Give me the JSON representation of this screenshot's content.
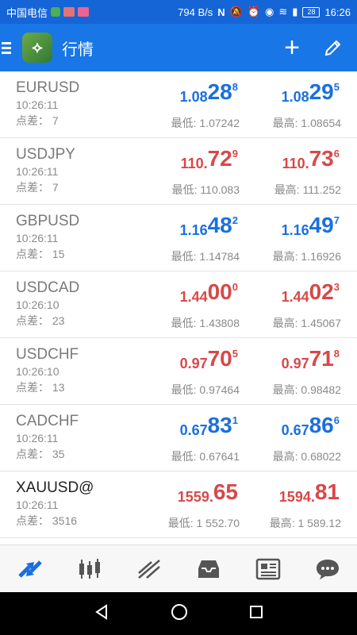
{
  "status_bar": {
    "carrier": "中国电信",
    "speed": "794 B/s",
    "battery": "28",
    "time": "16:26"
  },
  "app_bar": {
    "title": "行情"
  },
  "colors": {
    "primary": "#1976e6",
    "bid_ask_up": "#1a6fe0",
    "bid_ask_down": "#d84848"
  },
  "quotes": [
    {
      "symbol": "EURUSD",
      "time": "10:26:11",
      "spread_label": "点差：",
      "spread": "7",
      "bid": {
        "small": "1.08",
        "big": "28",
        "sup": "8",
        "color": "blue"
      },
      "ask": {
        "small": "1.08",
        "big": "29",
        "sup": "5",
        "color": "blue"
      },
      "low": "最低: 1.07242",
      "high": "最高: 1.08654"
    },
    {
      "symbol": "USDJPY",
      "time": "10:26:11",
      "spread_label": "点差：",
      "spread": "7",
      "bid": {
        "small": "110.",
        "big": "72",
        "sup": "9",
        "color": "red"
      },
      "ask": {
        "small": "110.",
        "big": "73",
        "sup": "6",
        "color": "red"
      },
      "low": "最低: 110.083",
      "high": "最高: 111.252"
    },
    {
      "symbol": "GBPUSD",
      "time": "10:26:11",
      "spread_label": "点差：",
      "spread": "15",
      "bid": {
        "small": "1.16",
        "big": "48",
        "sup": "2",
        "color": "blue"
      },
      "ask": {
        "small": "1.16",
        "big": "49",
        "sup": "7",
        "color": "blue"
      },
      "low": "最低: 1.14784",
      "high": "最高: 1.16926"
    },
    {
      "symbol": "USDCAD",
      "time": "10:26:10",
      "spread_label": "点差：",
      "spread": "23",
      "bid": {
        "small": "1.44",
        "big": "00",
        "sup": "0",
        "color": "red"
      },
      "ask": {
        "small": "1.44",
        "big": "02",
        "sup": "3",
        "color": "red"
      },
      "low": "最低: 1.43808",
      "high": "最高: 1.45067"
    },
    {
      "symbol": "USDCHF",
      "time": "10:26:10",
      "spread_label": "点差：",
      "spread": "13",
      "bid": {
        "small": "0.97",
        "big": "70",
        "sup": "5",
        "color": "red"
      },
      "ask": {
        "small": "0.97",
        "big": "71",
        "sup": "8",
        "color": "red"
      },
      "low": "最低: 0.97464",
      "high": "最高: 0.98482"
    },
    {
      "symbol": "CADCHF",
      "time": "10:26:11",
      "spread_label": "点差：",
      "spread": "35",
      "bid": {
        "small": "0.67",
        "big": "83",
        "sup": "1",
        "color": "blue"
      },
      "ask": {
        "small": "0.67",
        "big": "86",
        "sup": "6",
        "color": "blue"
      },
      "low": "最低: 0.67641",
      "high": "最高: 0.68022"
    },
    {
      "symbol": "XAUUSD@",
      "time": "10:26:11",
      "spread_label": "点差：",
      "spread": "3516",
      "bid": {
        "small": "1559.",
        "big": "65",
        "sup": "",
        "color": "red"
      },
      "ask": {
        "small": "1594.",
        "big": "81",
        "sup": "",
        "color": "red"
      },
      "low": "最低: 1 552.70",
      "high": "最高: 1 589.12",
      "dark": true
    }
  ],
  "bottom_nav": [
    "quotes-icon",
    "chart-candles-icon",
    "trade-icon",
    "inbox-icon",
    "news-icon",
    "chat-icon"
  ]
}
